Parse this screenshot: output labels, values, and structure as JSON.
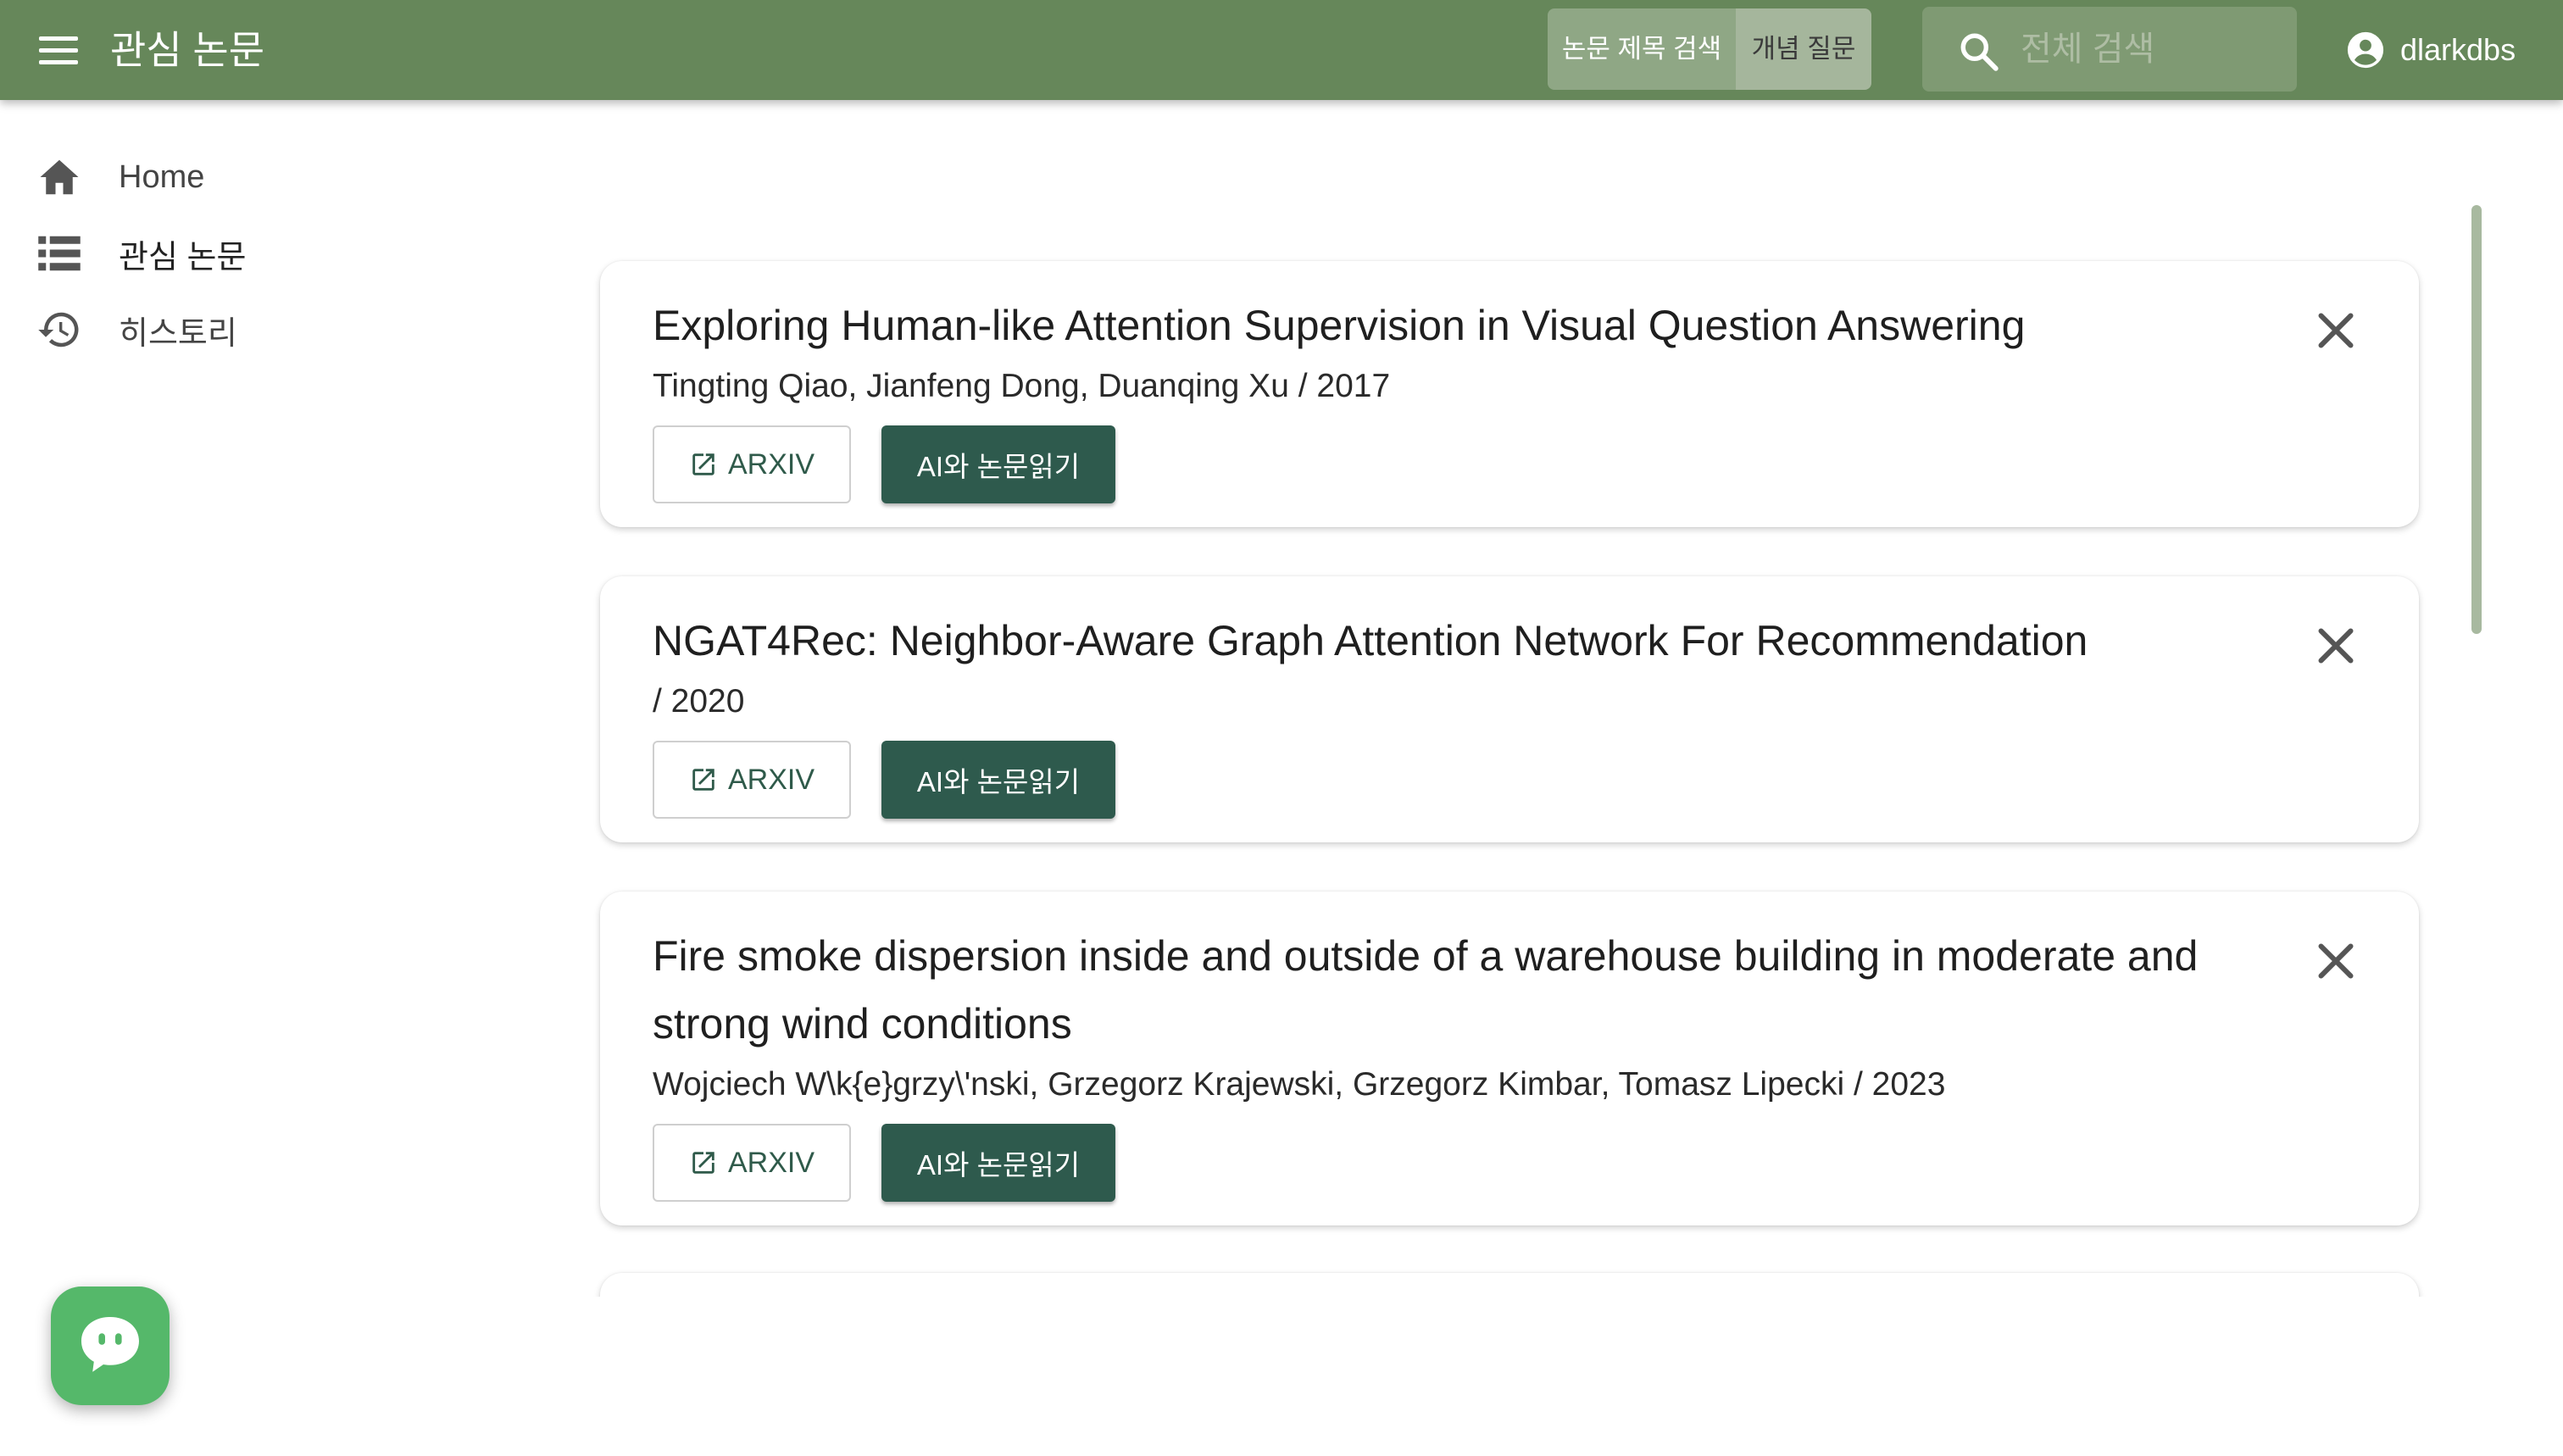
{
  "app": {
    "title": "관심 논문"
  },
  "header": {
    "title_search_label": "논문 제목 검색",
    "concept_question_label": "개념 질문",
    "search_placeholder": "전체 검색",
    "username": "dlarkdbs"
  },
  "sidebar": {
    "items": [
      {
        "label": "Home",
        "icon": "home-icon"
      },
      {
        "label": "관심 논문",
        "icon": "list-icon"
      },
      {
        "label": "히스토리",
        "icon": "history-icon"
      }
    ]
  },
  "papers": [
    {
      "title": "Exploring Human-like Attention Supervision in Visual Question Answering",
      "authors_year": "Tingting Qiao, Jianfeng Dong, Duanqing Xu / 2017",
      "arxiv_label": "ARXIV",
      "ai_label": "AI와 논문읽기"
    },
    {
      "title": "NGAT4Rec: Neighbor-Aware Graph Attention Network For Recommendation",
      "authors_year": "/ 2020",
      "arxiv_label": "ARXIV",
      "ai_label": "AI와 논문읽기"
    },
    {
      "title": "Fire smoke dispersion inside and outside of a warehouse building in moderate and strong wind conditions",
      "authors_year": "Wojciech W\\k{e}grzy\\'nski, Grzegorz Krajewski, Grzegorz Kimbar, Tomasz Lipecki / 2023",
      "arxiv_label": "ARXIV",
      "ai_label": "AI와 논문읽기"
    }
  ],
  "colors": {
    "appbar": "#66875a",
    "ai_button": "#2e5a4d",
    "chat_fab": "#55b86a"
  }
}
